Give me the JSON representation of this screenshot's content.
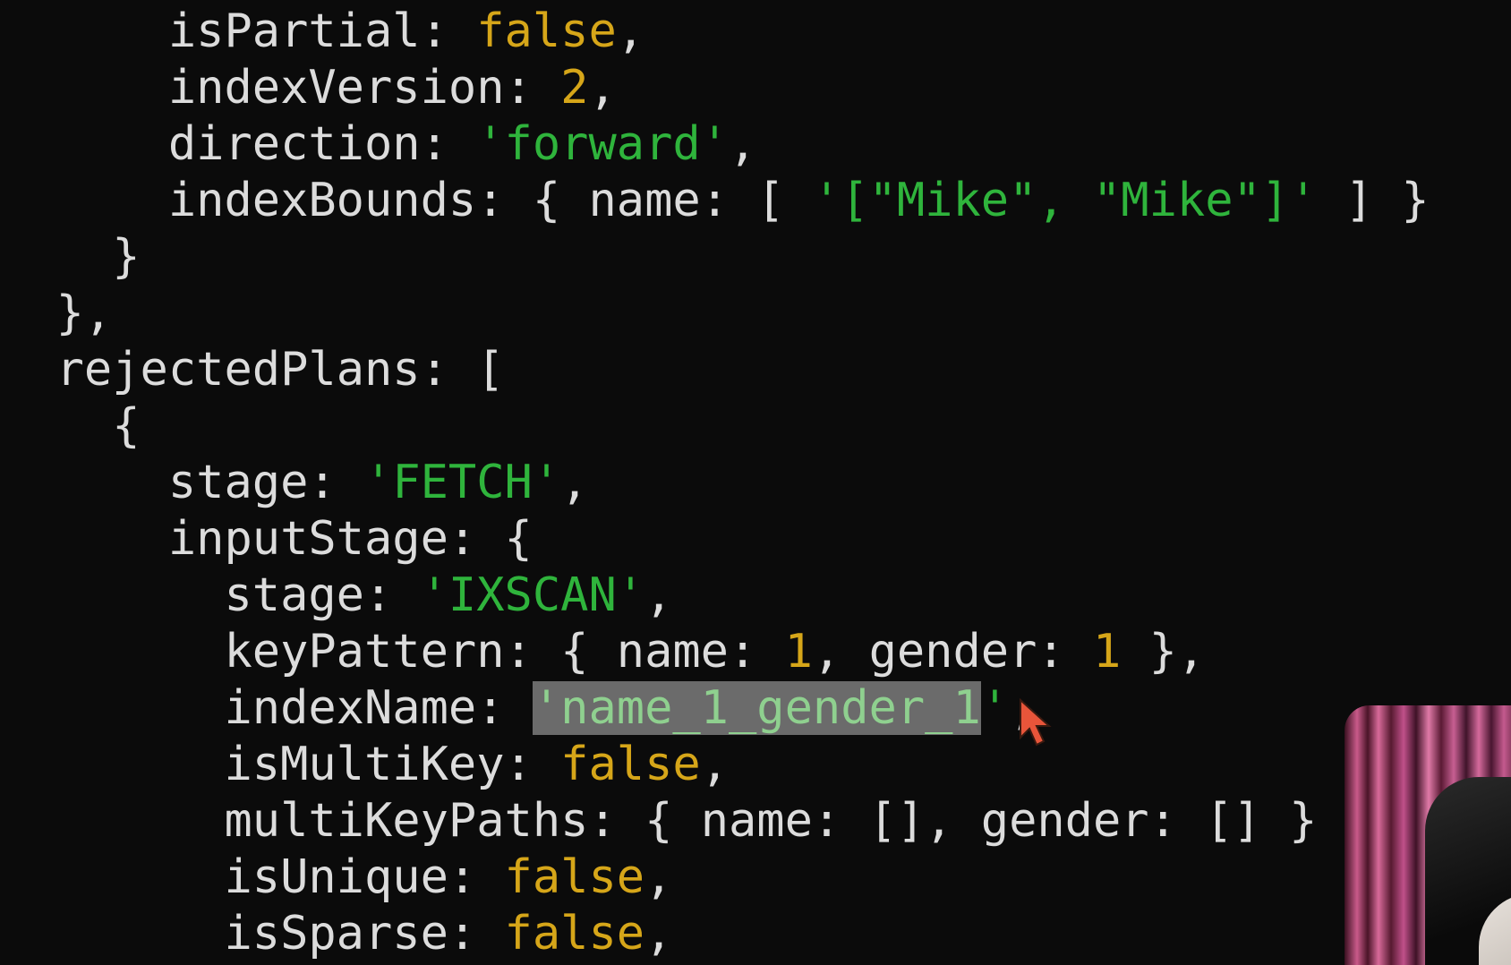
{
  "lines": [
    {
      "indent": "      ",
      "tokens": [
        {
          "t": "k",
          "v": "isPartial"
        },
        {
          "t": "p",
          "v": ": "
        },
        {
          "t": "b",
          "v": "false"
        },
        {
          "t": "p",
          "v": ","
        }
      ]
    },
    {
      "indent": "      ",
      "tokens": [
        {
          "t": "k",
          "v": "indexVersion"
        },
        {
          "t": "p",
          "v": ": "
        },
        {
          "t": "n",
          "v": "2"
        },
        {
          "t": "p",
          "v": ","
        }
      ]
    },
    {
      "indent": "      ",
      "tokens": [
        {
          "t": "k",
          "v": "direction"
        },
        {
          "t": "p",
          "v": ": "
        },
        {
          "t": "s",
          "v": "'forward'"
        },
        {
          "t": "p",
          "v": ","
        }
      ]
    },
    {
      "indent": "      ",
      "tokens": [
        {
          "t": "k",
          "v": "indexBounds"
        },
        {
          "t": "p",
          "v": ": { "
        },
        {
          "t": "k",
          "v": "name"
        },
        {
          "t": "p",
          "v": ": [ "
        },
        {
          "t": "s",
          "v": "'[\"Mike\", \"Mike\"]'"
        },
        {
          "t": "p",
          "v": " ] }"
        }
      ]
    },
    {
      "indent": "    ",
      "tokens": [
        {
          "t": "p",
          "v": "}"
        }
      ]
    },
    {
      "indent": "  ",
      "tokens": [
        {
          "t": "p",
          "v": "},"
        }
      ]
    },
    {
      "indent": "  ",
      "tokens": [
        {
          "t": "k",
          "v": "rejectedPlans"
        },
        {
          "t": "p",
          "v": ": ["
        }
      ]
    },
    {
      "indent": "    ",
      "tokens": [
        {
          "t": "p",
          "v": "{"
        }
      ]
    },
    {
      "indent": "      ",
      "tokens": [
        {
          "t": "k",
          "v": "stage"
        },
        {
          "t": "p",
          "v": ": "
        },
        {
          "t": "s",
          "v": "'FETCH'"
        },
        {
          "t": "p",
          "v": ","
        }
      ]
    },
    {
      "indent": "      ",
      "tokens": [
        {
          "t": "k",
          "v": "inputStage"
        },
        {
          "t": "p",
          "v": ": {"
        }
      ]
    },
    {
      "indent": "        ",
      "tokens": [
        {
          "t": "k",
          "v": "stage"
        },
        {
          "t": "p",
          "v": ": "
        },
        {
          "t": "s",
          "v": "'IXSCAN'"
        },
        {
          "t": "p",
          "v": ","
        }
      ]
    },
    {
      "indent": "        ",
      "tokens": [
        {
          "t": "k",
          "v": "keyPattern"
        },
        {
          "t": "p",
          "v": ": { "
        },
        {
          "t": "k",
          "v": "name"
        },
        {
          "t": "p",
          "v": ": "
        },
        {
          "t": "n",
          "v": "1"
        },
        {
          "t": "p",
          "v": ", "
        },
        {
          "t": "k",
          "v": "gender"
        },
        {
          "t": "p",
          "v": ": "
        },
        {
          "t": "n",
          "v": "1"
        },
        {
          "t": "p",
          "v": " },"
        }
      ]
    },
    {
      "indent": "        ",
      "tokens": [
        {
          "t": "k",
          "v": "indexName"
        },
        {
          "t": "p",
          "v": ": "
        },
        {
          "t": "sel",
          "v": "'name_1_gender_1"
        },
        {
          "t": "s",
          "v": "'"
        },
        {
          "t": "p",
          "v": ","
        }
      ]
    },
    {
      "indent": "        ",
      "tokens": [
        {
          "t": "k",
          "v": "isMultiKey"
        },
        {
          "t": "p",
          "v": ": "
        },
        {
          "t": "b",
          "v": "false"
        },
        {
          "t": "p",
          "v": ","
        }
      ]
    },
    {
      "indent": "        ",
      "tokens": [
        {
          "t": "k",
          "v": "multiKeyPaths"
        },
        {
          "t": "p",
          "v": ": { "
        },
        {
          "t": "k",
          "v": "name"
        },
        {
          "t": "p",
          "v": ": [], "
        },
        {
          "t": "k",
          "v": "gender"
        },
        {
          "t": "p",
          "v": ": [] }"
        }
      ]
    },
    {
      "indent": "        ",
      "tokens": [
        {
          "t": "k",
          "v": "isUnique"
        },
        {
          "t": "p",
          "v": ": "
        },
        {
          "t": "b",
          "v": "false"
        },
        {
          "t": "p",
          "v": ","
        }
      ]
    },
    {
      "indent": "        ",
      "tokens": [
        {
          "t": "k",
          "v": "isSparse"
        },
        {
          "t": "p",
          "v": ": "
        },
        {
          "t": "b",
          "v": "false"
        },
        {
          "t": "p",
          "v": ","
        }
      ]
    }
  ],
  "colors": {
    "background": "#0b0b0b",
    "key": "#dcdcdc",
    "string": "#2fb43c",
    "number": "#d6a619",
    "boolean": "#d6a619",
    "selection_bg": "#6b6b6b",
    "cursor": "#e8553a"
  },
  "icons": {
    "cursor": "mouse-pointer-icon"
  }
}
